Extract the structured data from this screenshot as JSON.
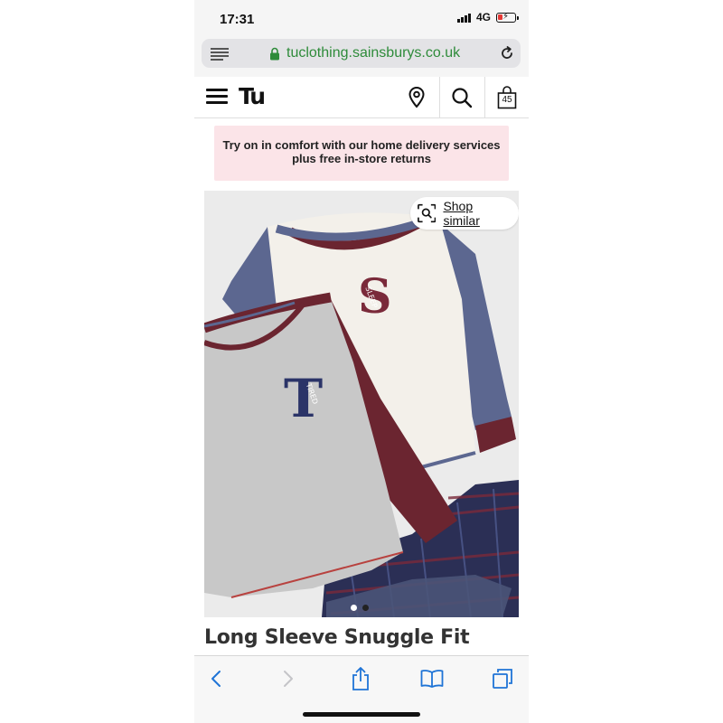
{
  "status_bar": {
    "time": "17:31",
    "network": "4G"
  },
  "browser": {
    "url": "tuclothing.sainsburys.co.uk",
    "url_color": "#2e8b3a",
    "icons": [
      "reader-menu-icon",
      "lock-icon",
      "reload-icon"
    ]
  },
  "header": {
    "logo": "Tu",
    "bag_count": "45",
    "icons": [
      "hamburger-icon",
      "location-pin-icon",
      "search-icon",
      "shopping-bag-icon"
    ]
  },
  "promo": {
    "line1": "Try on in comfort with our home delivery services",
    "line2": "plus free in-store returns",
    "background": "#fbe4e8"
  },
  "product": {
    "shop_similar_label": "Shop similar",
    "gallery": {
      "current_index": 0,
      "total": 2
    },
    "title": "Long Sleeve Snuggle Fit",
    "print_front_letter": "T",
    "print_front_word": "TIRED",
    "print_back_letter": "S",
    "print_back_word": "SLEEP"
  },
  "toolbar": {
    "icons": [
      "back-icon",
      "forward-icon",
      "share-icon",
      "bookmarks-icon",
      "tabs-icon"
    ],
    "accent": "#1f74d6"
  }
}
